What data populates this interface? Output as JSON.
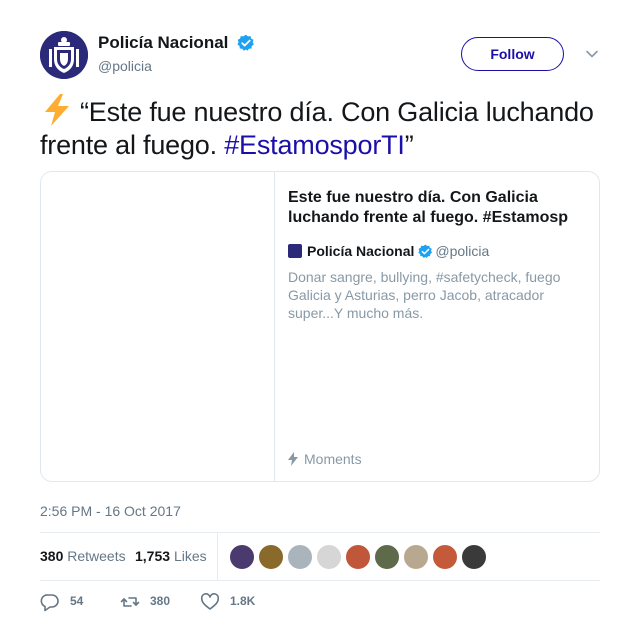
{
  "author": {
    "display_name": "Policía Nacional",
    "handle": "@policia",
    "avatar_icon": "police-badge-icon",
    "brand_color": "#2b2a7a"
  },
  "follow_label": "Follow",
  "tweet": {
    "emoji": "high-voltage-emoji",
    "text_open": "“Este fue nuestro día. Con Galicia luchando frente al fuego. ",
    "hashtag": "#EstamosporTI",
    "text_close": "”"
  },
  "card": {
    "title": "Este fue nuestro día. Con Galicia luchando frente al fuego. #Estamosp",
    "author_name": "Policía Nacional",
    "author_handle": "@policia",
    "description": "Donar sangre, bullying, #safetycheck, fuego Galicia y Asturias, perro Jacob, atracador super...Y mucho más.",
    "footer_label": "Moments"
  },
  "timestamp": "2:56 PM - 16 Oct 2017",
  "stats": {
    "retweets_count": "380",
    "retweets_label": "Retweets",
    "likes_count": "1,753",
    "likes_label": "Likes"
  },
  "liker_colors": [
    "#4a3a6e",
    "#8a6a2a",
    "#aab4bd",
    "#d6d6d6",
    "#c0563a",
    "#5e6a4a",
    "#b8a890",
    "#c45a3a",
    "#3a3a3a"
  ],
  "actions": {
    "replies": "54",
    "retweets": "380",
    "likes": "1.8K"
  },
  "colors": {
    "accent": "#1b0fa8",
    "verified": "#1da1f2",
    "muted": "#657786"
  }
}
